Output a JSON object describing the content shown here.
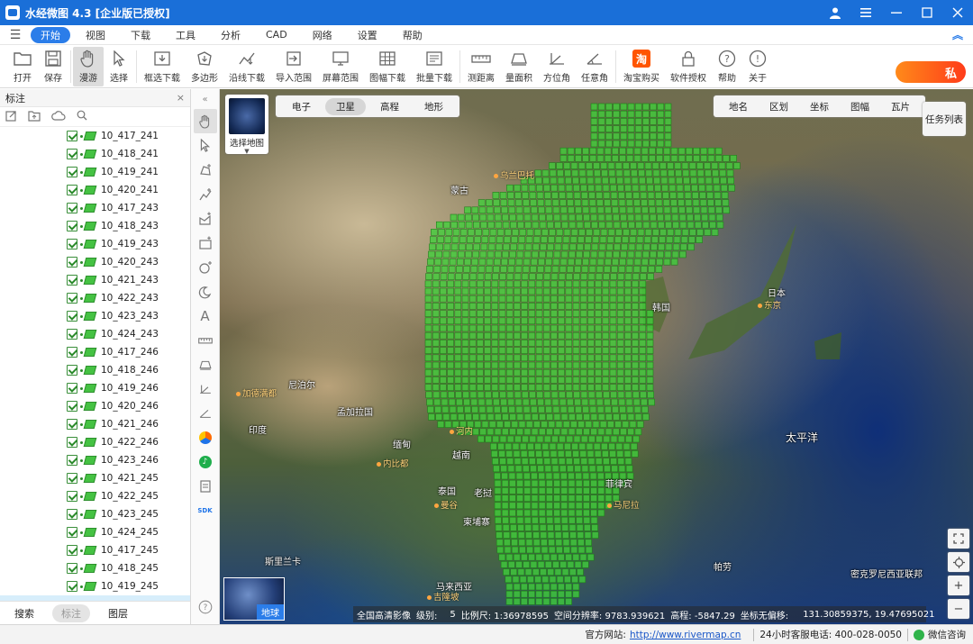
{
  "app": {
    "title": "水经微图 4.3 [企业版已授权]",
    "window_controls": [
      "user-icon",
      "menu-icon",
      "minimize-icon",
      "maximize-icon",
      "close-icon"
    ]
  },
  "menu": {
    "items": [
      "开始",
      "视图",
      "下载",
      "工具",
      "分析",
      "CAD",
      "网络",
      "设置",
      "帮助"
    ],
    "active": "开始"
  },
  "toolbar": {
    "items": [
      {
        "label": "打开",
        "icon": "folder-icon"
      },
      {
        "label": "保存",
        "icon": "save-icon"
      },
      {
        "label": "漫游",
        "icon": "hand-icon",
        "active": true
      },
      {
        "label": "选择",
        "icon": "pointer-icon"
      },
      {
        "label": "框选下载",
        "icon": "box-download-icon"
      },
      {
        "label": "多边形",
        "icon": "polygon-download-icon"
      },
      {
        "label": "沿线下载",
        "icon": "line-download-icon"
      },
      {
        "label": "导入范围",
        "icon": "import-icon"
      },
      {
        "label": "屏幕范围",
        "icon": "screen-icon"
      },
      {
        "label": "图幅下载",
        "icon": "sheet-icon"
      },
      {
        "label": "批量下载",
        "icon": "batch-icon"
      },
      {
        "label": "测距离",
        "icon": "ruler-icon"
      },
      {
        "label": "量面积",
        "icon": "area-icon"
      },
      {
        "label": "方位角",
        "icon": "azimuth-icon"
      },
      {
        "label": "任意角",
        "icon": "angle-icon"
      },
      {
        "label": "淘宝购买",
        "icon": "taobao-icon"
      },
      {
        "label": "软件授权",
        "icon": "lock-icon"
      },
      {
        "label": "帮助",
        "icon": "help-icon"
      },
      {
        "label": "关于",
        "icon": "info-icon"
      }
    ],
    "private_label": "私",
    "taobao_glyph": "淘"
  },
  "left_panel": {
    "title": "标注",
    "close": "×",
    "items": [
      "10_417_241",
      "10_418_241",
      "10_419_241",
      "10_420_241",
      "10_417_243",
      "10_418_243",
      "10_419_243",
      "10_420_243",
      "10_421_243",
      "10_422_243",
      "10_423_243",
      "10_424_243",
      "10_417_246",
      "10_418_246",
      "10_419_246",
      "10_420_246",
      "10_421_246",
      "10_422_246",
      "10_423_246",
      "10_421_245",
      "10_422_245",
      "10_423_245",
      "10_424_245",
      "10_417_245",
      "10_418_245",
      "10_419_245"
    ],
    "tabs": [
      "搜索",
      "标注",
      "图层"
    ],
    "active_tab": "标注"
  },
  "map": {
    "basemap_label": "选择地图",
    "types": [
      "电子",
      "卫星",
      "高程",
      "地形"
    ],
    "active_type": "卫星",
    "overlays": [
      "地名",
      "区划",
      "坐标",
      "图幅",
      "瓦片"
    ],
    "task_list": "任务列表",
    "earth_label": "地球",
    "places": [
      {
        "name": "蒙古",
        "kind": "country"
      },
      {
        "name": "乌兰巴托",
        "kind": "city"
      },
      {
        "name": "韩国",
        "kind": "country"
      },
      {
        "name": "日本",
        "kind": "country"
      },
      {
        "name": "东京",
        "kind": "city"
      },
      {
        "name": "尼泊尔",
        "kind": "country"
      },
      {
        "name": "加德满都",
        "kind": "city"
      },
      {
        "name": "印度",
        "kind": "country"
      },
      {
        "name": "孟加拉国",
        "kind": "country"
      },
      {
        "name": "缅甸",
        "kind": "country"
      },
      {
        "name": "内比都",
        "kind": "city"
      },
      {
        "name": "老挝",
        "kind": "country"
      },
      {
        "name": "泰国",
        "kind": "country"
      },
      {
        "name": "曼谷",
        "kind": "city"
      },
      {
        "name": "柬埔寨",
        "kind": "country"
      },
      {
        "name": "菲律宾",
        "kind": "country"
      },
      {
        "name": "马尼拉",
        "kind": "city"
      },
      {
        "name": "太平洋",
        "kind": "ocean"
      },
      {
        "name": "斯里兰卡",
        "kind": "country"
      },
      {
        "name": "马来西亚",
        "kind": "country"
      },
      {
        "name": "吉隆坡",
        "kind": "city"
      },
      {
        "name": "帕劳",
        "kind": "country"
      },
      {
        "name": "密克罗尼西亚联邦",
        "kind": "country"
      },
      {
        "name": "河内",
        "kind": "city"
      },
      {
        "name": "越南",
        "kind": "country"
      }
    ],
    "tile_color": "#3fcf3a",
    "status": {
      "source": "全国高清影像",
      "level_label": "级别:",
      "level": "5",
      "scale_label": "比例尺: 1:36978595",
      "resolution_label": "空间分辨率: 9783.939621",
      "elevation_label": "高程: -5847.29",
      "coord_label": "坐标无偏移:",
      "coords": "131.30859375, 19.47695021"
    }
  },
  "footer": {
    "site_label": "官方网站:",
    "site_url": "http://www.rivermap.cn",
    "hotline": "24小时客服电话: 400-028-0050",
    "wechat": "微信咨询"
  },
  "colors": {
    "titlebar": "#1a6fd8",
    "accent": "#2b7de9",
    "tile_green": "#3fcf3a",
    "private_button": "#ff5a1a"
  }
}
